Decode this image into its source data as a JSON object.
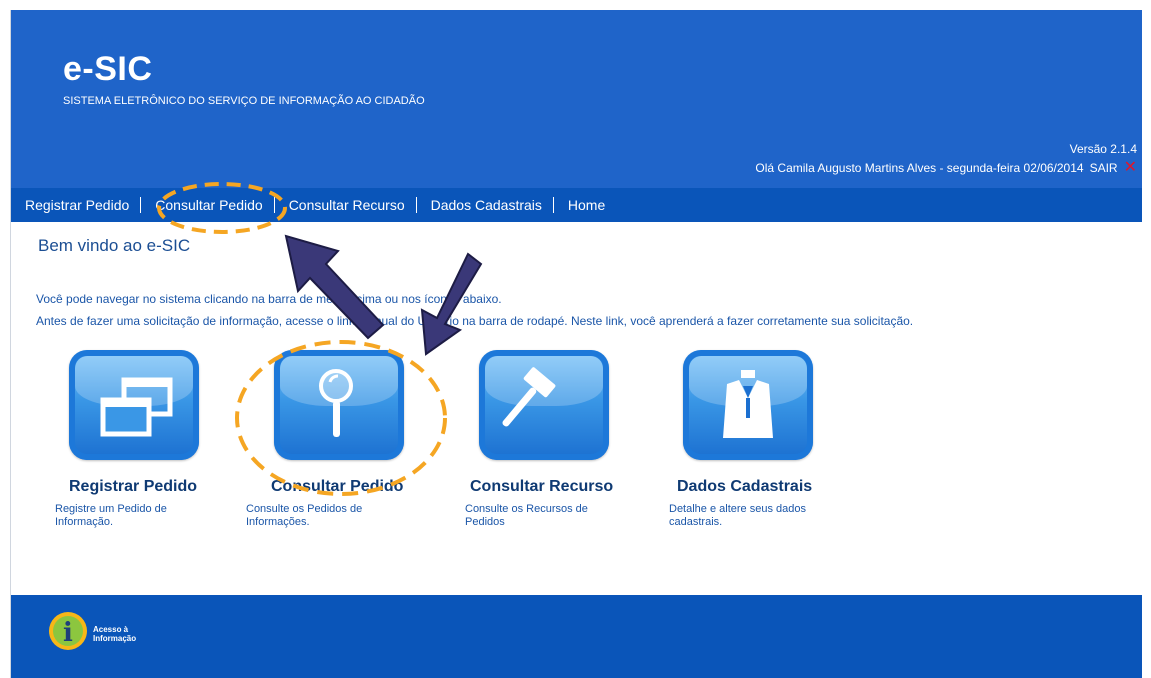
{
  "header": {
    "title": "e-SIC",
    "subtitle": "SISTEMA ELETRÔNICO DO SERVIÇO DE INFORMAÇÃO AO CIDADÃO",
    "version": "Versão 2.1.4",
    "greeting": "Olá Camila Augusto Martins Alves - segunda-feira 02/06/2014",
    "logout_label": "SAIR"
  },
  "nav": {
    "items": [
      {
        "label": "Registrar Pedido"
      },
      {
        "label": "Consultar Pedido"
      },
      {
        "label": "Consultar Recurso"
      },
      {
        "label": "Dados Cadastrais"
      },
      {
        "label": "Home"
      }
    ]
  },
  "content": {
    "welcome": "Bem vindo ao e-SIC",
    "intro1": "Você pode navegar no sistema clicando na barra de menu acima ou nos ícones abaixo.",
    "intro2": "Antes de fazer uma solicitação de informação, acesse o link Manual do Usuário na barra de rodapé. Neste link, você aprenderá a fazer corretamente sua solicitação.",
    "tiles": [
      {
        "title": "Registrar Pedido",
        "desc": "Registre um Pedido de Informação.",
        "icon": "windows-icon"
      },
      {
        "title": "Consultar Pedido",
        "desc": "Consulte os Pedidos de Informações.",
        "icon": "magnifier-icon"
      },
      {
        "title": "Consultar Recurso",
        "desc": "Consulte os Recursos de Pedidos",
        "icon": "gavel-icon"
      },
      {
        "title": "Dados Cadastrais",
        "desc": "Detalhe e altere seus dados cadastrais.",
        "icon": "suit-icon"
      }
    ]
  },
  "footer": {
    "acesso_line1": "Acesso à",
    "acesso_line2": "Informação",
    "acesso_badge_letter": "i"
  },
  "colors": {
    "header_bg": "#1f64c9",
    "nav_bg": "#0a55b9",
    "annotation_orange": "#f5a623",
    "annotation_arrow": "#2b2a5e",
    "close_red": "#e0162b"
  }
}
